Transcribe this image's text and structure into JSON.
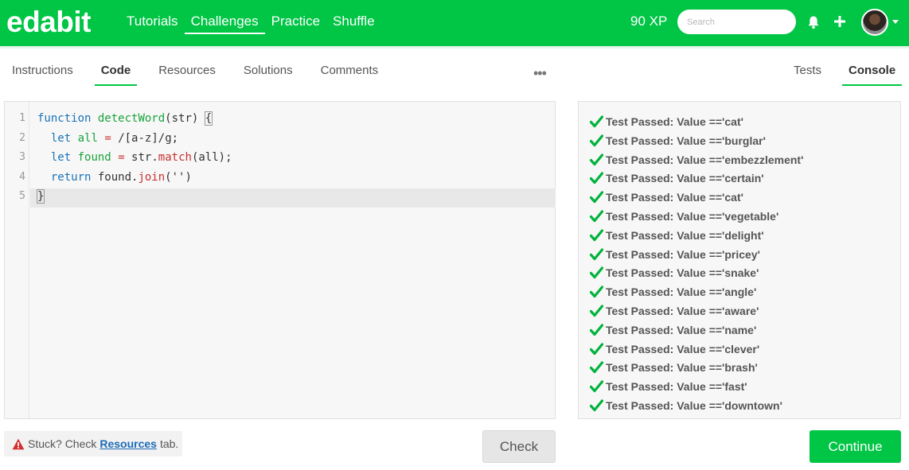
{
  "navbar": {
    "logo": "edabit",
    "links": [
      "Tutorials",
      "Challenges",
      "Practice",
      "Shuffle"
    ],
    "active_link": "Challenges",
    "xp": "90 XP",
    "search_placeholder": "Search"
  },
  "tabs": {
    "left": [
      "Instructions",
      "Code",
      "Resources",
      "Solutions",
      "Comments"
    ],
    "left_active": "Code",
    "more": "•••",
    "right": [
      "Tests",
      "Console"
    ],
    "right_active": "Console"
  },
  "editor": {
    "line_numbers": [
      "1",
      "2",
      "3",
      "4",
      "5"
    ]
  },
  "console": {
    "prefix": "Test Passed: Value == ",
    "values": [
      "'cat'",
      "'burglar'",
      "'embezzlement'",
      "'certain'",
      "'cat'",
      "'vegetable'",
      "'delight'",
      "'pricey'",
      "'snake'",
      "'angle'",
      "'aware'",
      "'name'",
      "'clever'",
      "'brash'",
      "'fast'",
      "'downtown'"
    ]
  },
  "footer": {
    "stuck_prefix": "Stuck? Check",
    "stuck_link": "Resources",
    "stuck_suffix": "tab.",
    "check_label": "Check",
    "continue_label": "Continue"
  },
  "colors": {
    "brand": "#00c545",
    "link": "#1a6bb8",
    "keyword": "#1a73b8",
    "function": "#1aa33b",
    "operator": "#c83030",
    "warning": "#d32f2f"
  }
}
